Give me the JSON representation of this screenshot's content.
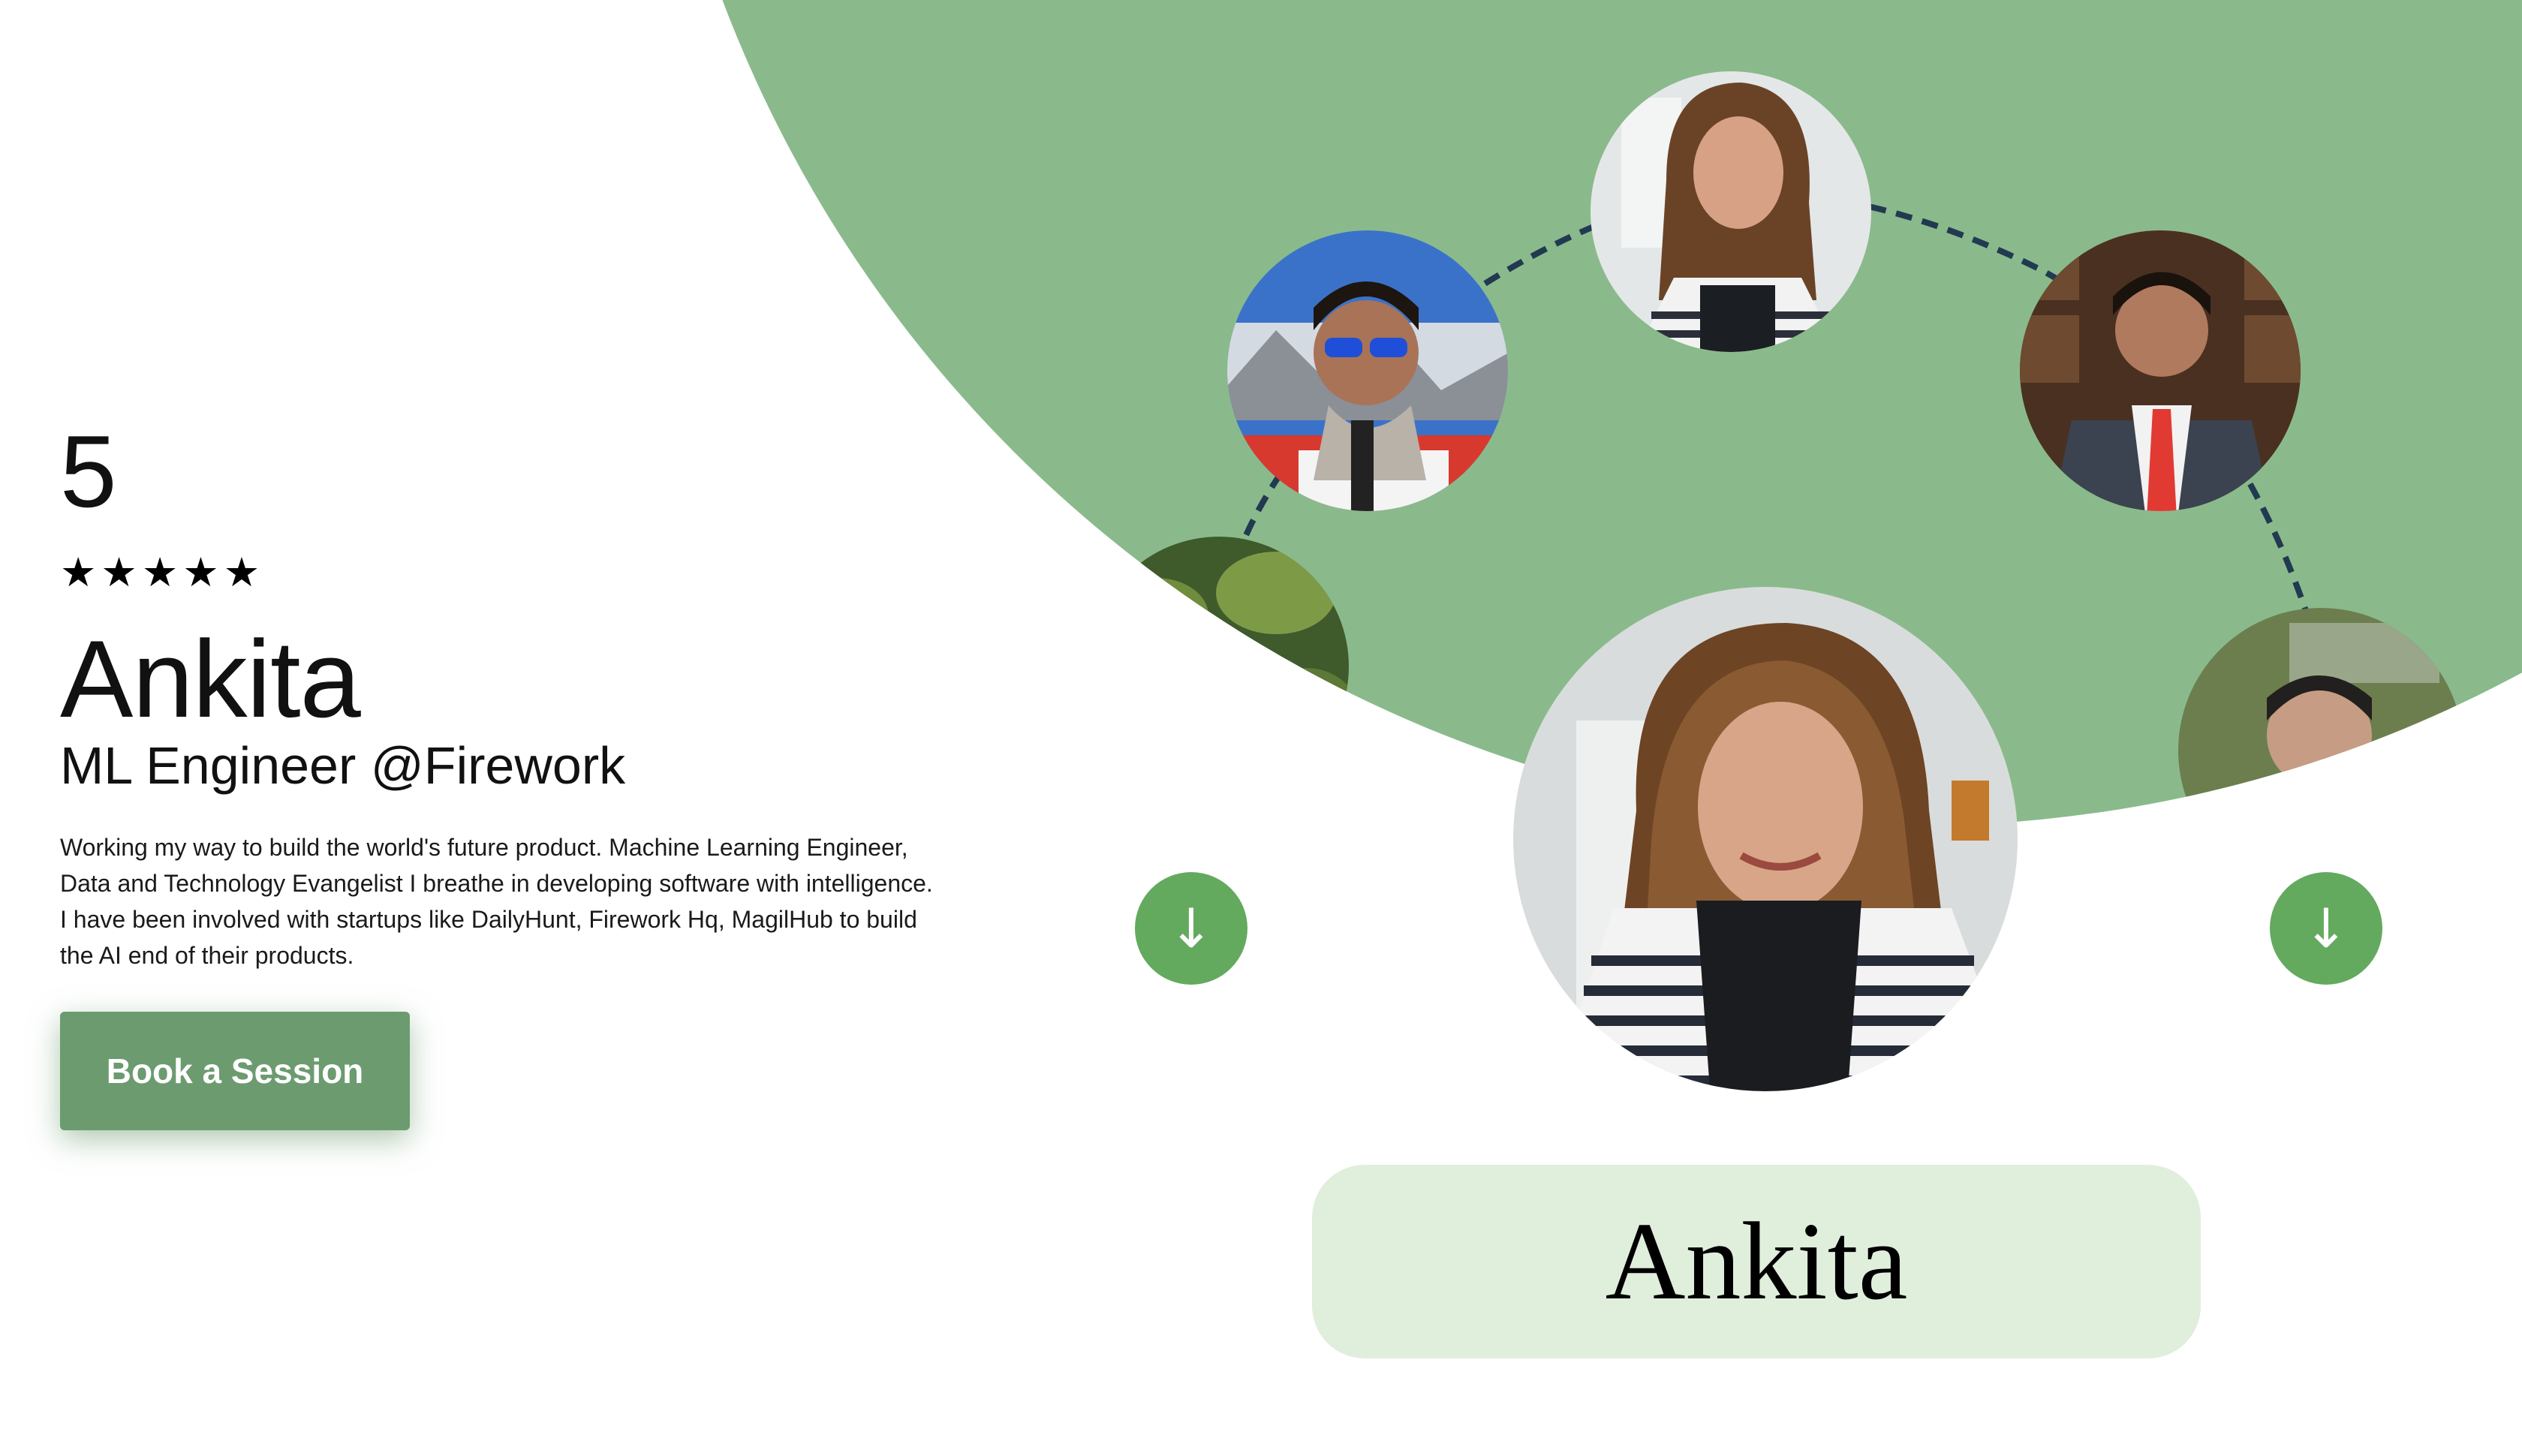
{
  "profile": {
    "rating": "5",
    "stars": [
      "★",
      "★",
      "★",
      "★",
      "★"
    ],
    "name": "Ankita",
    "role": "ML Engineer @Firework",
    "bio": "Working my way to build the world's future product. Machine Learning Engineer, Data and Technology Evangelist I breathe in developing software with intelligence. I have been involved with startups like DailyHunt, Firework Hq, MagilHub to build the AI end of their products.",
    "cta_label": "Book a Session"
  },
  "carousel": {
    "arrow_glyph": "↓",
    "selected_name": "Ankita"
  },
  "colors": {
    "disc": "#8aba8b",
    "button": "#6c9b70",
    "arrow_button": "#63aa5f",
    "name_card": "#e0eedc",
    "dashed_path": "#213a52"
  }
}
